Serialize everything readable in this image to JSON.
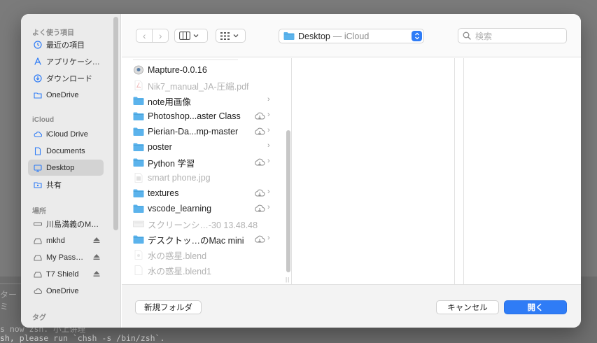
{
  "background": {
    "tab_label": "ターミ",
    "terminal_lines": [
      "s now zsh. 小上讲理",
      "sh, please run `chsh -s /bin/zsh`."
    ]
  },
  "sidebar": {
    "sections": [
      {
        "title": "よく使う項目"
      },
      {
        "title": "iCloud"
      },
      {
        "title": "場所"
      },
      {
        "title": "タグ"
      }
    ],
    "favorites": [
      {
        "label": "最近の項目",
        "icon": "clock-icon"
      },
      {
        "label": "アプリケーシ…",
        "icon": "applications-icon"
      },
      {
        "label": "ダウンロード",
        "icon": "download-icon"
      },
      {
        "label": "OneDrive",
        "icon": "folder-icon"
      }
    ],
    "icloud": [
      {
        "label": "iCloud Drive",
        "icon": "cloud-icon"
      },
      {
        "label": "Documents",
        "icon": "document-icon"
      },
      {
        "label": "Desktop",
        "icon": "desktop-icon",
        "selected": true
      },
      {
        "label": "共有",
        "icon": "shared-folder-icon"
      }
    ],
    "locations": [
      {
        "label": "川島満義のM…",
        "icon": "computer-icon"
      },
      {
        "label": "mkhd",
        "icon": "drive-icon",
        "eject": true
      },
      {
        "label": "My Pass…",
        "icon": "drive-icon",
        "eject": true
      },
      {
        "label": "T7 Shield",
        "icon": "drive-icon",
        "eject": true
      },
      {
        "label": "OneDrive",
        "icon": "cloud-icon"
      }
    ]
  },
  "toolbar": {
    "back_glyph": "‹",
    "forward_glyph": "›",
    "location_name": "Desktop",
    "location_sub": "— iCloud",
    "search_placeholder": "検索"
  },
  "files": [
    {
      "name": "Mapture-0.0.16",
      "icon": "disk-image-icon",
      "dim": false,
      "cloud": false,
      "chevron": false
    },
    {
      "name": "Nik7_manual_JA-圧縮.pdf",
      "icon": "pdf-icon",
      "dim": true,
      "cloud": false,
      "chevron": false
    },
    {
      "name": "note用画像",
      "icon": "folder-icon",
      "dim": false,
      "cloud": false,
      "chevron": true
    },
    {
      "name": "Photoshop...aster Class",
      "icon": "folder-icon",
      "dim": false,
      "cloud": true,
      "chevron": true
    },
    {
      "name": "Pierian-Da...mp-master",
      "icon": "folder-icon",
      "dim": false,
      "cloud": true,
      "chevron": true
    },
    {
      "name": "poster",
      "icon": "folder-icon",
      "dim": false,
      "cloud": false,
      "chevron": true
    },
    {
      "name": "Python 学習",
      "icon": "folder-icon",
      "dim": false,
      "cloud": true,
      "chevron": true
    },
    {
      "name": "smart phone.jpg",
      "icon": "image-icon",
      "dim": true,
      "cloud": false,
      "chevron": false
    },
    {
      "name": "textures",
      "icon": "folder-icon",
      "dim": false,
      "cloud": true,
      "chevron": true
    },
    {
      "name": "vscode_learning",
      "icon": "folder-icon",
      "dim": false,
      "cloud": true,
      "chevron": true
    },
    {
      "name": "スクリーンシ…-30 13.48.48",
      "icon": "screenshot-icon",
      "dim": true,
      "cloud": false,
      "chevron": false
    },
    {
      "name": "デスクトッ…のMac mini",
      "icon": "folder-icon",
      "dim": false,
      "cloud": true,
      "chevron": true
    },
    {
      "name": "水の惑星.blend",
      "icon": "blend-file-icon",
      "dim": true,
      "cloud": false,
      "chevron": false
    },
    {
      "name": "水の惑星.blend1",
      "icon": "document-icon",
      "dim": true,
      "cloud": false,
      "chevron": false
    }
  ],
  "footer": {
    "new_folder_label": "新規フォルダ",
    "cancel_label": "キャンセル",
    "open_label": "開く"
  },
  "colors": {
    "accent": "#2f7cf6",
    "folder": "#5bb3ec",
    "sidebar_icon": "#2f7cf6"
  }
}
